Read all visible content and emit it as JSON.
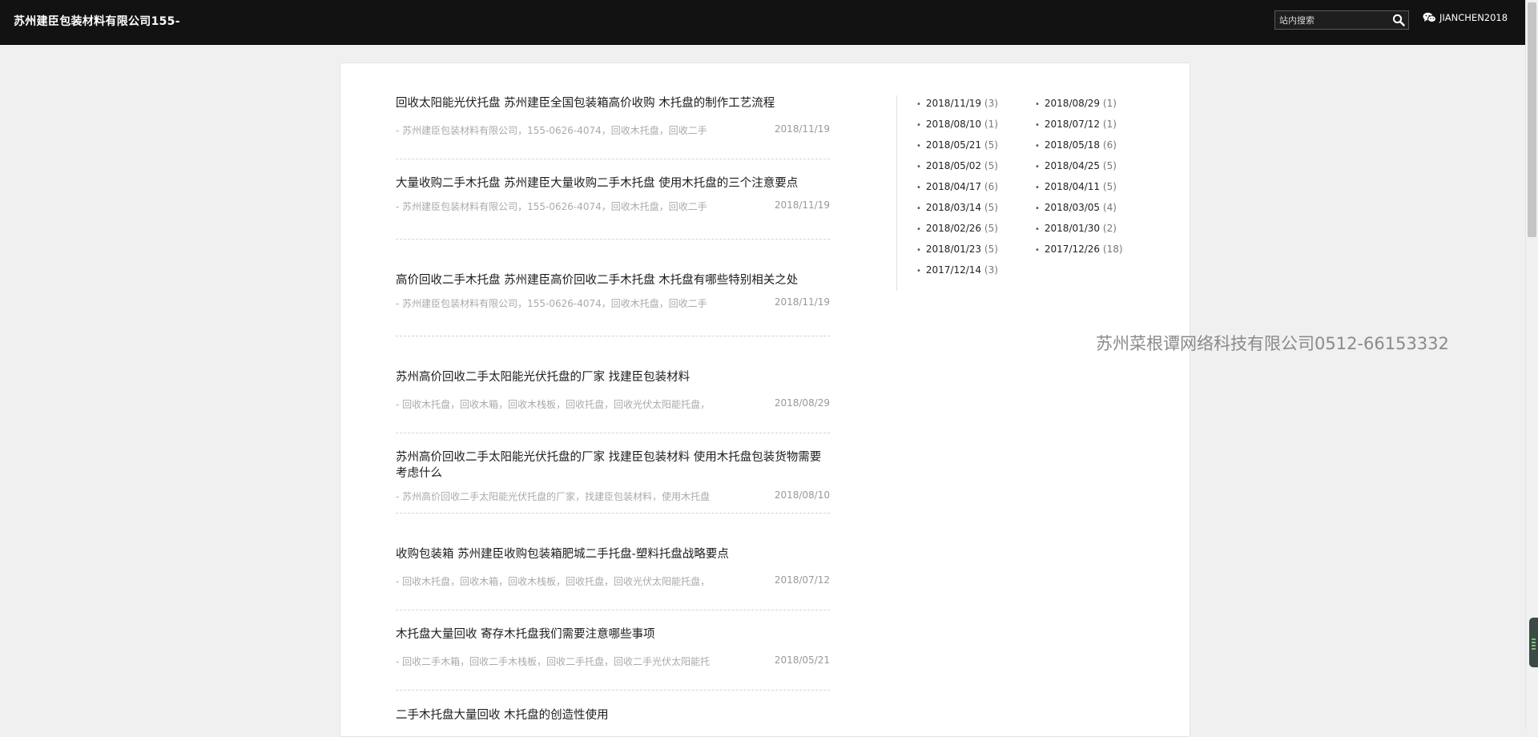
{
  "header": {
    "site_title": "苏州建臣包装材料有限公司155-",
    "search_placeholder": "站内搜索",
    "wechat_label": "JIANCHEN2018"
  },
  "posts": [
    {
      "title": "回收太阳能光伏托盘 苏州建臣全国包装箱高价收购 木托盘的制作工艺流程",
      "excerpt": "- 苏州建臣包装材料有限公司，155-0626-4074，回收木托盘，回收二手",
      "date": "2018/11/19"
    },
    {
      "title": "大量收购二手木托盘 苏州建臣大量收购二手木托盘 使用木托盘的三个注意要点",
      "excerpt": "- 苏州建臣包装材料有限公司，155-0626-4074，回收木托盘，回收二手",
      "date": "2018/11/19"
    },
    {
      "title": "高价回收二手木托盘 苏州建臣高价回收二手木托盘 木托盘有哪些特别相关之处",
      "excerpt": "- 苏州建臣包装材料有限公司，155-0626-4074，回收木托盘，回收二手",
      "date": "2018/11/19"
    },
    {
      "title": "苏州高价回收二手太阳能光伏托盘的厂家 找建臣包装材料",
      "excerpt": "- 回收木托盘，回收木箱，回收木栈板，回收托盘，回收光伏太阳能托盘，",
      "date": "2018/08/29"
    },
    {
      "title": "苏州高价回收二手太阳能光伏托盘的厂家 找建臣包装材料 使用木托盘包装货物需要考虑什么",
      "excerpt": "- 苏州高价回收二手太阳能光伏托盘的厂家，找建臣包装材料，使用木托盘",
      "date": "2018/08/10"
    },
    {
      "title": "收购包装箱 苏州建臣收购包装箱肥城二手托盘-塑料托盘战略要点",
      "excerpt": "- 回收木托盘，回收木箱，回收木栈板，回收托盘，回收光伏太阳能托盘，",
      "date": "2018/07/12"
    },
    {
      "title": "木托盘大量回收 寄存木托盘我们需要注意哪些事项",
      "excerpt": "- 回收二手木箱，回收二手木栈板，回收二手托盘，回收二手光伏太阳能托",
      "date": "2018/05/21"
    },
    {
      "title": "二手木托盘大量回收 木托盘的创造性使用",
      "excerpt": "",
      "date": ""
    }
  ],
  "archives": [
    {
      "date": "2018/11/19",
      "count": "(3)"
    },
    {
      "date": "2018/08/29",
      "count": "(1)"
    },
    {
      "date": "2018/08/10",
      "count": "(1)"
    },
    {
      "date": "2018/07/12",
      "count": "(1)"
    },
    {
      "date": "2018/05/21",
      "count": "(5)"
    },
    {
      "date": "2018/05/18",
      "count": "(6)"
    },
    {
      "date": "2018/05/02",
      "count": "(5)"
    },
    {
      "date": "2018/04/25",
      "count": "(5)"
    },
    {
      "date": "2018/04/17",
      "count": "(6)"
    },
    {
      "date": "2018/04/11",
      "count": "(5)"
    },
    {
      "date": "2018/03/14",
      "count": "(5)"
    },
    {
      "date": "2018/03/05",
      "count": "(4)"
    },
    {
      "date": "2018/02/26",
      "count": "(5)"
    },
    {
      "date": "2018/01/30",
      "count": "(2)"
    },
    {
      "date": "2018/01/23",
      "count": "(5)"
    },
    {
      "date": "2017/12/26",
      "count": "(18)"
    },
    {
      "date": "2017/12/14",
      "count": "(3)"
    }
  ],
  "watermark": "苏州菜根谭网络科技有限公司0512-66153332",
  "icons": {
    "search": "search-icon",
    "wechat": "wechat-icon"
  }
}
